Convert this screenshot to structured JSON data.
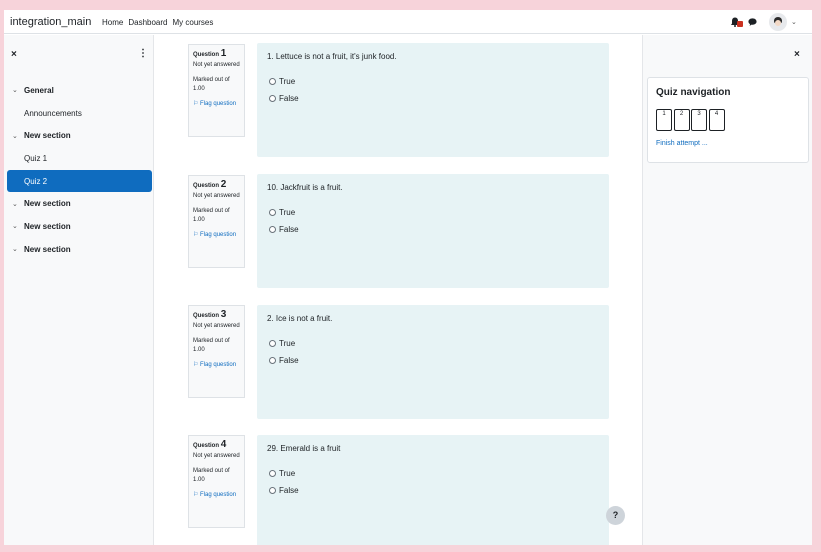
{
  "navbar": {
    "site_name": "integration_main",
    "links": [
      "Home",
      "Dashboard",
      "My courses"
    ],
    "icons": [
      "bell-icon",
      "chat-icon",
      "avatar"
    ]
  },
  "left_drawer": {
    "close_glyph": "×",
    "menu_glyph": "⋮",
    "items": [
      {
        "label": "General",
        "type": "section"
      },
      {
        "label": "Announcements",
        "type": "item"
      },
      {
        "label": "New section",
        "type": "section"
      },
      {
        "label": "Quiz 1",
        "type": "item"
      },
      {
        "label": "Quiz 2",
        "type": "item",
        "active": true
      },
      {
        "label": "New section",
        "type": "section"
      },
      {
        "label": "New section",
        "type": "section"
      },
      {
        "label": "New section",
        "type": "section"
      }
    ]
  },
  "questions": [
    {
      "label": "Question",
      "number": "1",
      "state": "Not yet answered",
      "mark": "Marked out of 1.00",
      "flag": "Flag question",
      "text": "1. Lettuce is not a fruit, it's junk food.",
      "options": [
        "True",
        "False"
      ]
    },
    {
      "label": "Question",
      "number": "2",
      "state": "Not yet answered",
      "mark": "Marked out of 1.00",
      "flag": "Flag question",
      "text": "10. Jackfruit is a fruit.",
      "options": [
        "True",
        "False"
      ]
    },
    {
      "label": "Question",
      "number": "3",
      "state": "Not yet answered",
      "mark": "Marked out of 1.00",
      "flag": "Flag question",
      "text": "2. Ice is not a fruit.",
      "options": [
        "True",
        "False"
      ]
    },
    {
      "label": "Question",
      "number": "4",
      "state": "Not yet answered",
      "mark": "Marked out of 1.00",
      "flag": "Flag question",
      "text": "29. Emerald is a fruit",
      "options": [
        "True",
        "False"
      ]
    }
  ],
  "quiz_nav": {
    "title": "Quiz navigation",
    "buttons": [
      "1",
      "2",
      "3",
      "4"
    ],
    "finish": "Finish attempt ...",
    "close_glyph": "×"
  },
  "help": "?",
  "colors": {
    "accent": "#0f6cbf",
    "question_bg": "#e7f3f5",
    "page_bg": "#f7d3da"
  }
}
